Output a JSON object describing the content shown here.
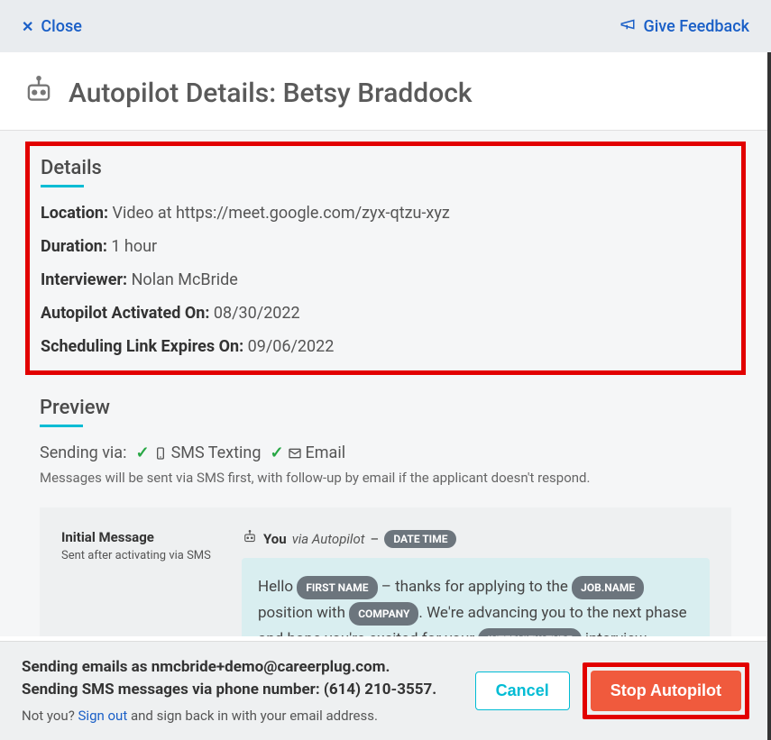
{
  "topbar": {
    "close_label": "Close",
    "feedback_label": "Give Feedback"
  },
  "header": {
    "title": "Autopilot Details: Betsy Braddock"
  },
  "details": {
    "heading": "Details",
    "rows": [
      {
        "label": "Location:",
        "value": " Video at https://meet.google.com/zyx-qtzu-xyz"
      },
      {
        "label": "Duration:",
        "value": " 1 hour"
      },
      {
        "label": "Interviewer:",
        "value": " Nolan McBride"
      },
      {
        "label": "Autopilot Activated On:",
        "value": " 08/30/2022"
      },
      {
        "label": "Scheduling Link Expires On:",
        "value": " 09/06/2022"
      }
    ]
  },
  "preview": {
    "heading": "Preview",
    "sending_via_label": "Sending via:",
    "sms_label": "SMS Texting",
    "email_label": "Email",
    "sending_note": "Messages will be sent via SMS first, with follow-up by email if the applicant doesn't respond.",
    "initial_message": {
      "title": "Initial Message",
      "subtitle": "Sent after activating via SMS",
      "you_label": "You",
      "via_label": "via ",
      "autopilot_label": "Autopilot",
      "dash": " – ",
      "datetime_pill": "DATE TIME",
      "body_parts": {
        "hello": "Hello ",
        "p1": " – thanks for applying to the ",
        "p2": " position with ",
        "p3": ". We're advancing you to the next phase and hope you're excited for your ",
        "p4": " interview",
        "firstname_pill": "FIRST NAME",
        "jobname_pill": "JOB.NAME",
        "company_pill": "COMPANY",
        "interviewtype_pill": "INTERVIEW.TYPE"
      }
    }
  },
  "footer": {
    "emails_line1a": "Sending emails as ",
    "emails_line1b": "nmcbride+demo@careerplug.com.",
    "sms_line2a": "Sending SMS messages via phone number: ",
    "sms_line2b": "(614) 210-3557.",
    "notyou_prefix": "Not you? ",
    "signout_label": "Sign out",
    "notyou_suffix": " and sign back in with your email address.",
    "cancel_label": "Cancel",
    "stop_label": "Stop Autopilot"
  }
}
